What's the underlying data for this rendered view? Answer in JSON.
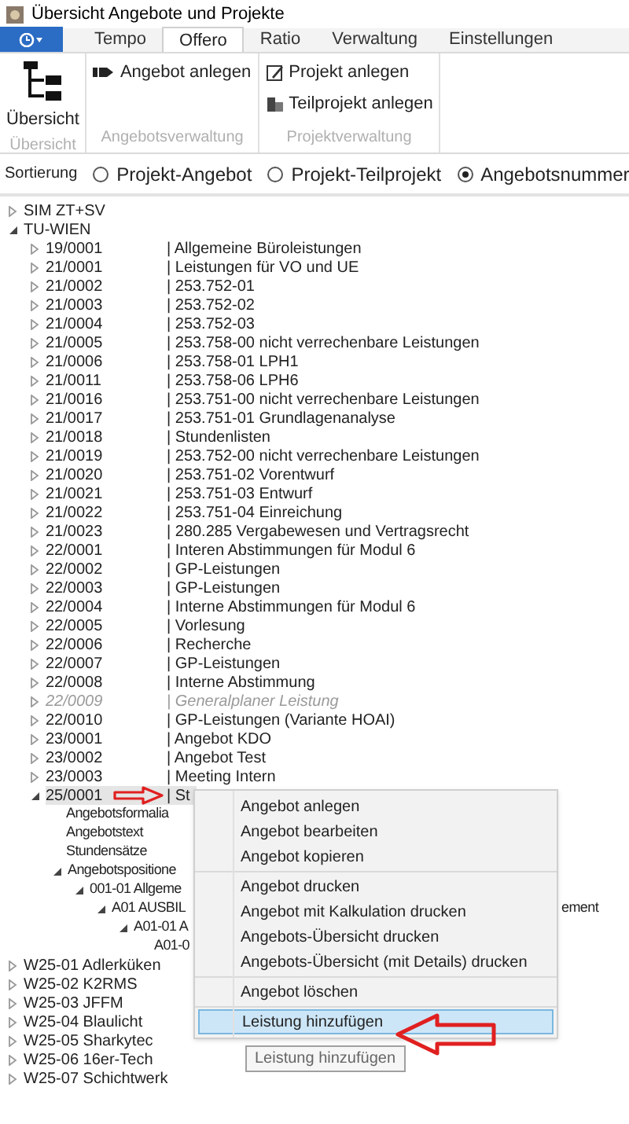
{
  "window": {
    "title": "Übersicht Angebote und Projekte"
  },
  "ribbon_tabs": [
    {
      "label": "Tempo",
      "selected": false
    },
    {
      "label": "Offero",
      "selected": true
    },
    {
      "label": "Ratio",
      "selected": false
    },
    {
      "label": "Verwaltung",
      "selected": false
    },
    {
      "label": "Einstellungen",
      "selected": false
    }
  ],
  "ribbon_groups": [
    {
      "label": "Übersicht",
      "kind": "large",
      "buttons": [
        {
          "label": "Übersicht"
        }
      ]
    },
    {
      "label": "Angebotsverwaltung",
      "kind": "small",
      "buttons": [
        {
          "label": "Angebot anlegen"
        }
      ]
    },
    {
      "label": "Projektverwaltung",
      "kind": "small",
      "buttons": [
        {
          "label": "Projekt anlegen"
        },
        {
          "label": "Teilprojekt anlegen"
        }
      ]
    }
  ],
  "sorting": {
    "label": "Sortierung",
    "options": [
      {
        "label": "Projekt-Angebot",
        "selected": false
      },
      {
        "label": "Projekt-Teilprojekt",
        "selected": false
      },
      {
        "label": "Angebotsnummer",
        "selected": true
      }
    ]
  },
  "tree": [
    {
      "label": "SIM ZT+SV",
      "kind": "node",
      "expanded": false
    },
    {
      "label": "TU-WIEN",
      "kind": "node",
      "expanded": true,
      "children": [
        {
          "number": "19/0001",
          "title": "| Allgemeine Büroleistungen",
          "kind": "node",
          "expanded": false,
          "inactive": false
        },
        {
          "number": "21/0001",
          "title": "| Leistungen für VO und UE",
          "kind": "node",
          "expanded": false,
          "inactive": false
        },
        {
          "number": "21/0002",
          "title": "| 253.752-01",
          "kind": "node",
          "expanded": false,
          "inactive": false
        },
        {
          "number": "21/0003",
          "title": "| 253.752-02",
          "kind": "node",
          "expanded": false,
          "inactive": false
        },
        {
          "number": "21/0004",
          "title": "| 253.752-03",
          "kind": "node",
          "expanded": false,
          "inactive": false
        },
        {
          "number": "21/0005",
          "title": "| 253.758-00 nicht verrechenbare Leistungen",
          "kind": "node",
          "expanded": false,
          "inactive": false
        },
        {
          "number": "21/0006",
          "title": "| 253.758-01 LPH1",
          "kind": "node",
          "expanded": false,
          "inactive": false
        },
        {
          "number": "21/0011",
          "title": "| 253.758-06 LPH6",
          "kind": "node",
          "expanded": false,
          "inactive": false
        },
        {
          "number": "21/0016",
          "title": "| 253.751-00 nicht verrechenbare Leistungen",
          "kind": "node",
          "expanded": false,
          "inactive": false
        },
        {
          "number": "21/0017",
          "title": "| 253.751-01 Grundlagenanalyse",
          "kind": "node",
          "expanded": false,
          "inactive": false
        },
        {
          "number": "21/0018",
          "title": "| Stundenlisten",
          "kind": "node",
          "expanded": false,
          "inactive": false
        },
        {
          "number": "21/0019",
          "title": "| 253.752-00 nicht verrechenbare Leistungen",
          "kind": "node",
          "expanded": false,
          "inactive": false
        },
        {
          "number": "21/0020",
          "title": "| 253.751-02 Vorentwurf",
          "kind": "node",
          "expanded": false,
          "inactive": false
        },
        {
          "number": "21/0021",
          "title": "| 253.751-03 Entwurf",
          "kind": "node",
          "expanded": false,
          "inactive": false
        },
        {
          "number": "21/0022",
          "title": "| 253.751-04 Einreichung",
          "kind": "node",
          "expanded": false,
          "inactive": false
        },
        {
          "number": "21/0023",
          "title": "| 280.285 Vergabewesen und Vertragsrecht",
          "kind": "node",
          "expanded": false,
          "inactive": false
        },
        {
          "number": "22/0001",
          "title": "| Interen Abstimmungen für Modul 6",
          "kind": "node",
          "expanded": false,
          "inactive": false
        },
        {
          "number": "22/0002",
          "title": "| GP-Leistungen",
          "kind": "node",
          "expanded": false,
          "inactive": false
        },
        {
          "number": "22/0003",
          "title": "| GP-Leistungen",
          "kind": "node",
          "expanded": false,
          "inactive": false
        },
        {
          "number": "22/0004",
          "title": "| Interne Abstimmungen für Modul 6",
          "kind": "node",
          "expanded": false,
          "inactive": false
        },
        {
          "number": "22/0005",
          "title": "| Vorlesung",
          "kind": "node",
          "expanded": false,
          "inactive": false
        },
        {
          "number": "22/0006",
          "title": "| Recherche",
          "kind": "node",
          "expanded": false,
          "inactive": false
        },
        {
          "number": "22/0007",
          "title": "| GP-Leistungen",
          "kind": "node",
          "expanded": false,
          "inactive": false
        },
        {
          "number": "22/0008",
          "title": "| Interne Abstimmung",
          "kind": "node",
          "expanded": false,
          "inactive": false
        },
        {
          "number": "22/0009",
          "title": "| Generalplaner Leistung",
          "kind": "node",
          "expanded": false,
          "inactive": true
        },
        {
          "number": "22/0010",
          "title": "| GP-Leistungen (Variante HOAI)",
          "kind": "node",
          "expanded": false,
          "inactive": false
        },
        {
          "number": "23/0001",
          "title": "| Angebot KDO",
          "kind": "node",
          "expanded": false,
          "inactive": false
        },
        {
          "number": "23/0002",
          "title": "| Angebot Test",
          "kind": "node",
          "expanded": false,
          "inactive": false
        },
        {
          "number": "23/0003",
          "title": "| Meeting Intern",
          "kind": "node",
          "expanded": false,
          "inactive": false
        },
        {
          "number": "25/0001",
          "title": "| St",
          "kind": "node",
          "expanded": true,
          "inactive": false,
          "selected": true,
          "children": [
            {
              "label": "Angebotsformalia",
              "kind": "leaf"
            },
            {
              "label": "Angebotstext",
              "kind": "leaf"
            },
            {
              "label": "Stundensätze",
              "kind": "leaf"
            },
            {
              "label": "Angebotspositione",
              "kind": "node",
              "expanded": true,
              "children": [
                {
                  "label": "001-01 Allgeme",
                  "kind": "node",
                  "expanded": true,
                  "children": [
                    {
                      "label": "A01 AUSBIL",
                      "tail": "ement",
                      "kind": "node",
                      "expanded": true,
                      "children": [
                        {
                          "label": "A01-01 A",
                          "kind": "node",
                          "expanded": true,
                          "children": [
                            {
                              "label": "A01-0",
                              "kind": "leaf"
                            }
                          ]
                        }
                      ]
                    }
                  ]
                }
              ]
            }
          ]
        }
      ]
    },
    {
      "label": "W25-01 Adlerküken",
      "kind": "node",
      "expanded": false
    },
    {
      "label": "W25-02 K2RMS",
      "kind": "node",
      "expanded": false
    },
    {
      "label": "W25-03 JFFM",
      "kind": "node",
      "expanded": false
    },
    {
      "label": "W25-04 Blaulicht",
      "kind": "node",
      "expanded": false
    },
    {
      "label": "W25-05 Sharkytec",
      "kind": "node",
      "expanded": false
    },
    {
      "label": "W25-06 16er-Tech",
      "kind": "node",
      "expanded": false
    },
    {
      "label": "W25-07 Schichtwerk",
      "kind": "node",
      "expanded": false
    }
  ],
  "context_menu": {
    "groups": [
      [
        {
          "label": "Angebot anlegen",
          "selected": false
        },
        {
          "label": "Angebot bearbeiten",
          "selected": false
        },
        {
          "label": "Angebot kopieren",
          "selected": false
        }
      ],
      [
        {
          "label": "Angebot drucken",
          "selected": false
        },
        {
          "label": "Angebot mit Kalkulation drucken",
          "selected": false
        },
        {
          "label": "Angebots-Übersicht drucken",
          "selected": false
        },
        {
          "label": "Angebots-Übersicht (mit Details) drucken",
          "selected": false
        }
      ],
      [
        {
          "label": "Angebot löschen",
          "selected": false
        }
      ],
      [
        {
          "label": "Leistung hinzufügen",
          "selected": true
        }
      ]
    ],
    "tooltip": "Leistung hinzufügen"
  }
}
